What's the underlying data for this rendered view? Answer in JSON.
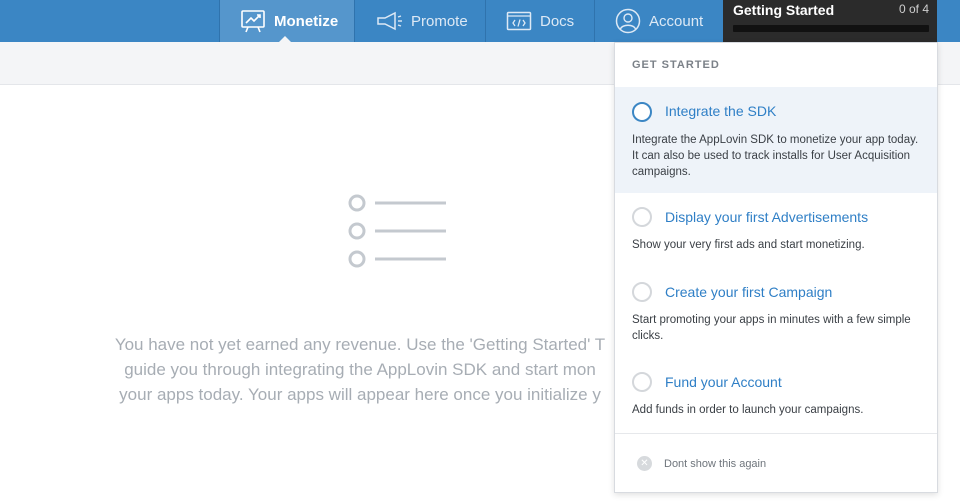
{
  "nav": {
    "monetize": "Monetize",
    "promote": "Promote",
    "docs": "Docs",
    "account": "Account"
  },
  "getting_started": {
    "title": "Getting Started",
    "progress_text": "0 of 4",
    "progress_fraction": 0
  },
  "empty_state": {
    "line1": "You have not yet earned any revenue. Use the 'Getting Started' T",
    "line2": "guide you through integrating the AppLovin SDK and start mon",
    "line3": "your apps today. Your apps will appear here once you initialize y"
  },
  "panel": {
    "heading": "GET STARTED",
    "steps": [
      {
        "title": "Integrate the SDK",
        "description": "Integrate the AppLovin SDK to monetize your app today. It can also be used to track installs for User Acquisition campaigns."
      },
      {
        "title": "Display your first Advertisements",
        "description": "Show your very first ads and start monetizing."
      },
      {
        "title": "Create your first Campaign",
        "description": "Start promoting your apps in minutes with a few simple clicks."
      },
      {
        "title": "Fund your Account",
        "description": "Add funds in order to launch your campaigns."
      }
    ],
    "dont_show": "Dont show this again"
  },
  "colors": {
    "nav_bg": "#3b86c4",
    "nav_active_bg": "#5596cc",
    "link_blue": "#2f7fc6",
    "muted_text": "#a7adb4"
  },
  "icons": {
    "monetize": "chart-board-icon",
    "promote": "megaphone-icon",
    "docs": "code-window-icon",
    "account": "user-circle-icon"
  }
}
